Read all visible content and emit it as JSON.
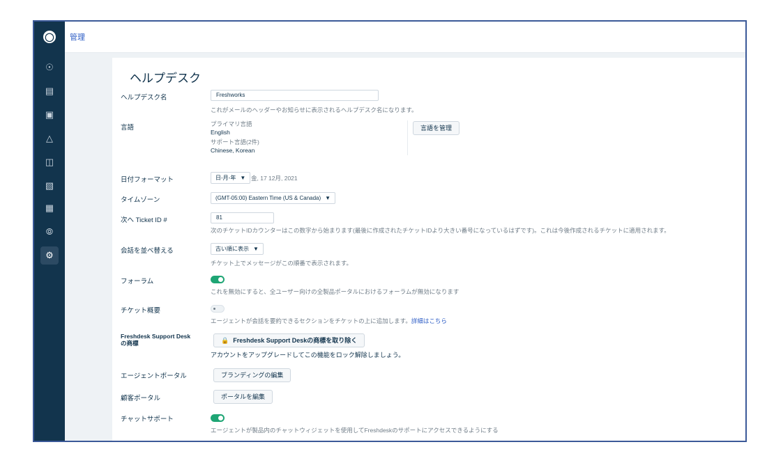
{
  "app": {
    "breadcrumb": "管理",
    "logo_icon": "headset-logo-icon"
  },
  "sidebar": {
    "icons": [
      "dashboard-icon",
      "tickets-icon",
      "contacts-icon",
      "groups-icon",
      "solutions-icon",
      "forums-icon",
      "reports-icon",
      "discover-icon",
      "admin-gear-icon"
    ],
    "active": "admin-gear-icon"
  },
  "page": {
    "title": "ヘルプデスク"
  },
  "helpdesk_name": {
    "label": "ヘルプデスク名",
    "value": "Freshworks",
    "hint": "これがメールのヘッダーやお知らせに表示されるヘルプデスク名になります。"
  },
  "language": {
    "label": "言語",
    "primary_label": "プライマリ言語",
    "primary_value": "English",
    "support_label": "サポート言語(2件)",
    "support_value": "Chinese, Korean",
    "manage_button": "言語を管理"
  },
  "date_format": {
    "label": "日付フォーマット",
    "selected": "日-月-年",
    "preview": "金, 17 12月, 2021"
  },
  "timezone": {
    "label": "タイムゾーン",
    "selected": "(GMT-05:00) Eastern Time (US & Canada)"
  },
  "ticket_id": {
    "label": "次へ Ticket ID #",
    "value": "81",
    "hint": "次のチケットIDカウンターはこの数字から始まります(最後に作成されたチケットIDより大きい番号になっているはずです)。これは今後作成されるチケットに適用されます。"
  },
  "conversation_sort": {
    "label": "会話を並べ替える",
    "selected": "古い順に表示",
    "hint": "チケット上でメッセージがこの順番で表示されます。"
  },
  "forum": {
    "label": "フォーラム",
    "enabled": true,
    "hint": "これを無効にすると、全ユーザー向けの全製品ポータルにおけるフォーラムが無効になります"
  },
  "ticket_summary": {
    "label": "チケット概要",
    "enabled": false,
    "hint": "エージェントが会話を要約できるセクションをチケットの上に追加します。",
    "link": "詳細はこちら"
  },
  "branding": {
    "label": "Freshdesk Support Desk の商標",
    "label_line1": "Freshdesk Support Desk",
    "label_line2": "の商標",
    "button": "Freshdesk Support Deskの商標を取り除く",
    "lock_icon": "lock-icon",
    "hint": "アカウントをアップグレードしてこの機能をロック解除しましょう。"
  },
  "agent_portal": {
    "label": "エージェントポータル",
    "button": "ブランディングの編集"
  },
  "customer_portal": {
    "label": "顧客ポータル",
    "button": "ポータルを編集"
  },
  "chat_support": {
    "label": "チャットサポート",
    "enabled": true,
    "hint": "エージェントが製品内のチャットウィジェットを使用してFreshdeskのサポートにアクセスできるようにする"
  },
  "colors": {
    "sidebar": "#12344d",
    "accent": "#2c5cc5",
    "toggle_on": "#1ea574",
    "frame_border": "#3b5998"
  }
}
